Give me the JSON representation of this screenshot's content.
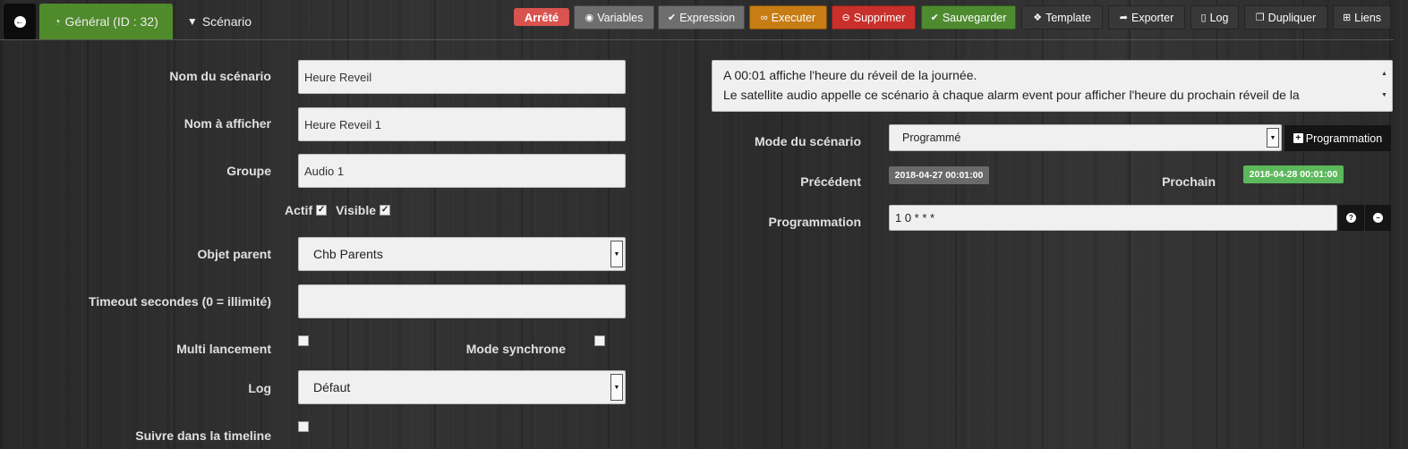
{
  "tabs": {
    "back_icon": "arrow-left-circle-icon",
    "general": "Général (ID : 32)",
    "general_icon": "dashboard-icon",
    "scenario": "Scénario",
    "scenario_icon": "filter-icon"
  },
  "status": {
    "label": "Arrêté",
    "color": "#d9534f"
  },
  "toolbar": {
    "variables": "Variables",
    "expression": "Expression",
    "executer": "Executer",
    "supprimer": "Supprimer",
    "sauvegarder": "Sauvegarder",
    "template": "Template",
    "exporter": "Exporter",
    "log": "Log",
    "dupliquer": "Dupliquer",
    "liens": "Liens"
  },
  "form": {
    "nom_label": "Nom du scénario",
    "nom_value": "Heure Reveil",
    "afficher_label": "Nom à afficher",
    "afficher_value": "Heure Reveil 1",
    "groupe_label": "Groupe",
    "groupe_value": "Audio 1",
    "actif_label": "Actif",
    "actif_checked": true,
    "visible_label": "Visible",
    "visible_checked": true,
    "parent_label": "Objet parent",
    "parent_value": "Chb Parents",
    "timeout_label": "Timeout secondes (0 = illimité)",
    "timeout_value": "",
    "multi_label": "Multi lancement",
    "multi_checked": false,
    "sync_label": "Mode synchrone",
    "sync_checked": false,
    "log_label": "Log",
    "log_value": "Défaut",
    "timeline_label": "Suivre dans la timeline",
    "timeline_checked": false
  },
  "right": {
    "description_line1": "A 00:01 affiche l'heure du réveil de la journée.",
    "description_line2": "Le satellite audio appelle ce scénario à chaque alarm event pour afficher l'heure du prochain réveil de la",
    "mode_label": "Mode du scénario",
    "mode_value": "Programmé",
    "programmation_button": "Programmation",
    "precedent_label": "Précédent",
    "precedent_value": "2018-04-27 00:01:00",
    "prochain_label": "Prochain",
    "prochain_value": "2018-04-28 00:01:00",
    "programmation_label": "Programmation",
    "programmation_value": "1 0 * * *"
  }
}
